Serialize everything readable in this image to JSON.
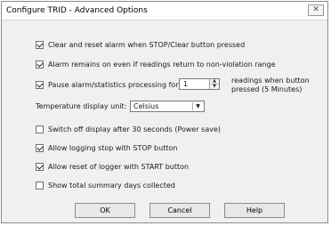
{
  "window": {
    "title": "Configure TRID - Advanced Options",
    "close_glyph": "✕"
  },
  "options": [
    {
      "label": "Clear and reset alarm when STOP/Clear button pressed",
      "checked": true
    },
    {
      "label": "Alarm remains on even if readings return to non-violation range",
      "checked": true
    },
    {
      "label": "Pause alarm/statistics processing for",
      "checked": true
    },
    {
      "label": "Switch off display after 30 seconds (Power save)",
      "checked": false
    },
    {
      "label": "Allow logging stop with STOP button",
      "checked": true
    },
    {
      "label": "Allow reset of logger with START button",
      "checked": true
    },
    {
      "label": "Show total summary days collected",
      "checked": false
    }
  ],
  "pause": {
    "value": "1",
    "suffix_line1": "readings when button",
    "suffix_line2": "pressed (5 Minutes)",
    "up_glyph": "▲",
    "down_glyph": "▼"
  },
  "temperature": {
    "label": "Temperature display unit:",
    "value": "Celsius",
    "arrow_glyph": "▼"
  },
  "buttons": {
    "ok": "OK",
    "cancel": "Cancel",
    "help": "Help"
  }
}
